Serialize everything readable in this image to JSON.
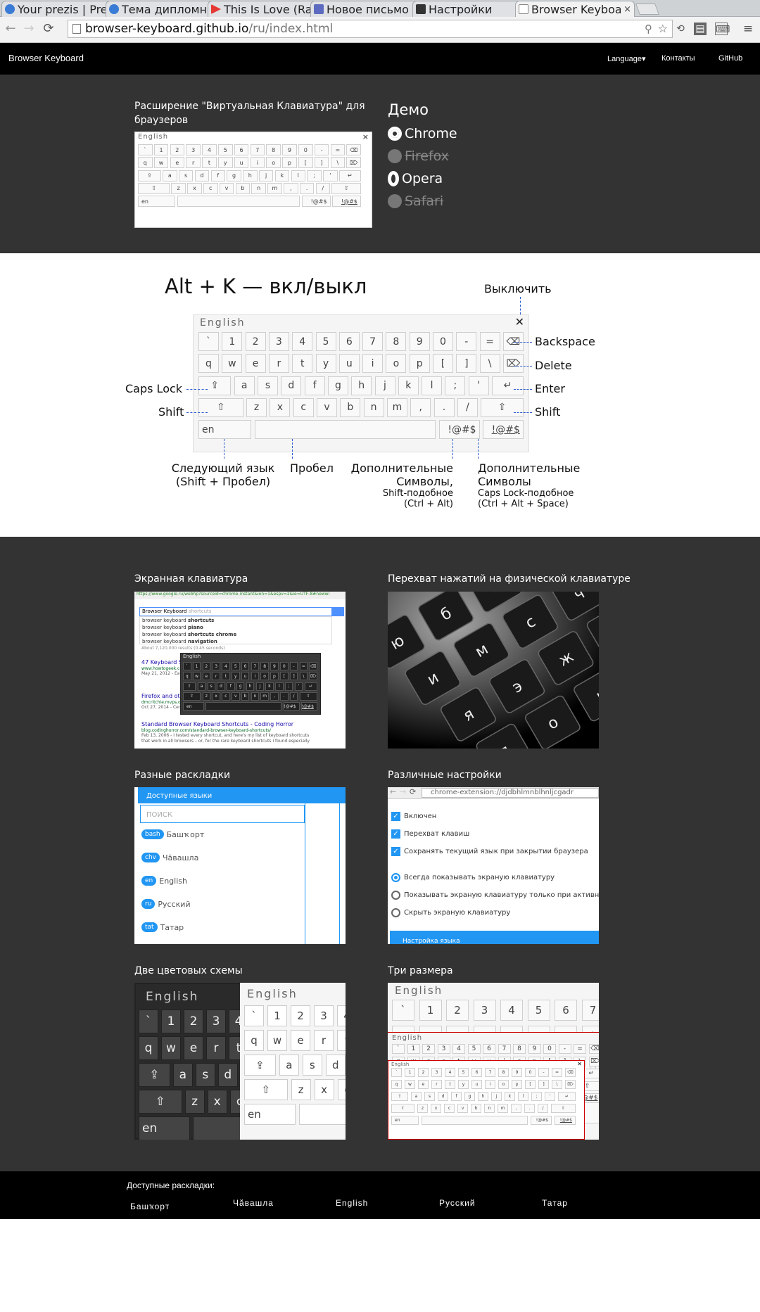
{
  "browser": {
    "tabs": [
      {
        "label": "Your prezis | Pre",
        "icon": "prezi-icon",
        "color": "#3a7bd5"
      },
      {
        "label": "Тема дипломно",
        "icon": "prezi-icon",
        "color": "#3a7bd5"
      },
      {
        "label": "This Is Love (Ra",
        "icon": "play-icon",
        "color": "#e53935"
      },
      {
        "label": "Новое письмо",
        "icon": "mail-icon",
        "color": "#5c6bc0"
      },
      {
        "label": "Настройки",
        "icon": "settings-page-icon",
        "color": "#333333"
      },
      {
        "label": "Browser Keyboa",
        "icon": "page-icon",
        "color": "#888888"
      }
    ],
    "close_glyph": "×",
    "url_domain": "browser-keyboard.github.io",
    "url_path": "/ru/index.html"
  },
  "site": {
    "brand": "Browser Keyboard",
    "nav": {
      "language": "Language",
      "language_caret": "▾",
      "contacts": "Контакты",
      "github": "GitHub"
    }
  },
  "hero": {
    "title": "Расширение \"Виртуальная Клавиатура\" для браузеров",
    "keyboard_lang": "English",
    "close_glyph": "×",
    "demo_title": "Демо",
    "browsers": [
      {
        "name": "Chrome",
        "enabled": true,
        "icon": "chrome-icon"
      },
      {
        "name": "Firefox",
        "enabled": false,
        "icon": "firefox-icon"
      },
      {
        "name": "Opera",
        "enabled": true,
        "icon": "opera-icon"
      },
      {
        "name": "Safari",
        "enabled": false,
        "icon": "safari-icon"
      }
    ]
  },
  "keyboard": {
    "title": "English",
    "rows": [
      [
        "`",
        "1",
        "2",
        "3",
        "4",
        "5",
        "6",
        "7",
        "8",
        "9",
        "0",
        "-",
        "=",
        "⌫"
      ],
      [
        "q",
        "w",
        "e",
        "r",
        "t",
        "y",
        "u",
        "i",
        "o",
        "p",
        "[",
        "]",
        "\\",
        "⌦"
      ],
      [
        "⇪",
        "a",
        "s",
        "d",
        "f",
        "g",
        "h",
        "j",
        "k",
        "l",
        ";",
        "'",
        "↵"
      ],
      [
        "⇧",
        "z",
        "x",
        "c",
        "v",
        "b",
        "n",
        "m",
        ",",
        ".",
        "/",
        "⇧"
      ],
      [
        "en",
        "",
        "!@#$",
        "!@#$"
      ]
    ]
  },
  "diagram": {
    "shortcut": "Alt + K — вкл/выкл",
    "off_label": "Выключить",
    "backspace": "Backspace",
    "delete": "Delete",
    "enter": "Enter",
    "shift_right": "Shift",
    "caps_lock": "Caps Lock",
    "shift_left": "Shift",
    "next_lang": [
      "Следующий язык",
      "(Shift + Пробел)"
    ],
    "space": "Пробел",
    "extra1": [
      "Дополнительные",
      "Символы,",
      "Shift-подобное",
      "(Ctrl + Alt)"
    ],
    "extra2": [
      "Дополнительные",
      "Символы",
      "Caps Lock-подобное",
      "(Ctrl + Alt + Space)"
    ]
  },
  "features": [
    {
      "title": "Экранная клавиатура",
      "kind": "screen"
    },
    {
      "title": "Перехват нажатий на физической клавиатуре",
      "kind": "photo"
    },
    {
      "title": "Разные раскладки",
      "kind": "layouts"
    },
    {
      "title": "Различные настройки",
      "kind": "settings"
    },
    {
      "title": "Две цветовых схемы",
      "kind": "schemes"
    },
    {
      "title": "Три размера",
      "kind": "sizes"
    }
  ],
  "screen_shot": {
    "url": "https://www.google.ru/webhp?sourceid=chrome-instant&ion=1&espv=2&ie=UTF-8#newwi",
    "query": "Browser Keyboard",
    "query_hint": "shortcuts",
    "suggestions": [
      {
        "base": "browser keyboard ",
        "bold": "shortcuts"
      },
      {
        "base": "browser keyboard ",
        "bold": "piano"
      },
      {
        "base": "browser keyboard ",
        "bold": "shortcuts chrome"
      },
      {
        "base": "browser keyboard ",
        "bold": "navigation"
      }
    ],
    "results_count": "About 7,120,000 results (0.45 seconds)",
    "results": [
      {
        "title": "47 Keyboard S",
        "url": "www.howtogeek.co",
        "snippet": "May 21, 2012 - Each"
      },
      {
        "title": "Firefox and oth",
        "url": "dmcritchie.mvps.or",
        "snippet": "Oct 27, 2014 - Cent"
      },
      {
        "title": "Standard Browser Keyboard Shortcuts - Coding Horror",
        "url": "blog.codinghorror.com/standard-browser-keyboard-shortcuts/",
        "snippet": "Feb 13, 2006 - I tested every shortcut, and here's my list of keyboard shortcuts that work in all browsers – or, for the rare keyboard shortcuts I found especially"
      }
    ]
  },
  "layouts_shot": {
    "header": "Доступные языки",
    "search_placeholder": "поиск",
    "items": [
      {
        "code": "bash",
        "name": "Башҡорт"
      },
      {
        "code": "chv",
        "name": "Чӑвашла"
      },
      {
        "code": "en",
        "name": "English"
      },
      {
        "code": "ru",
        "name": "Русский"
      },
      {
        "code": "tat",
        "name": "Татар"
      }
    ]
  },
  "settings_shot": {
    "url": "chrome-extension://djdbhlmnblhnljcgadr",
    "checkboxes": [
      "Включен",
      "Перехват клавиш",
      "Сохранять текущий язык при закрытии браузера"
    ],
    "radios": [
      "Всегда показывать экраную клавиатуру",
      "Показывать экраную клавиатуру только при активном",
      "Скрыть экраную клавиатуру"
    ],
    "button": "Настройка языка"
  },
  "footer": {
    "title": "Доступные раскладки:",
    "layouts": [
      "Башҡорт",
      "Чӑвашла",
      "English",
      "Русский",
      "Татар"
    ]
  },
  "colors": {
    "accent": "#2196f3",
    "dark": "#333333",
    "black": "#000000",
    "guide": "#2b5bd1"
  }
}
